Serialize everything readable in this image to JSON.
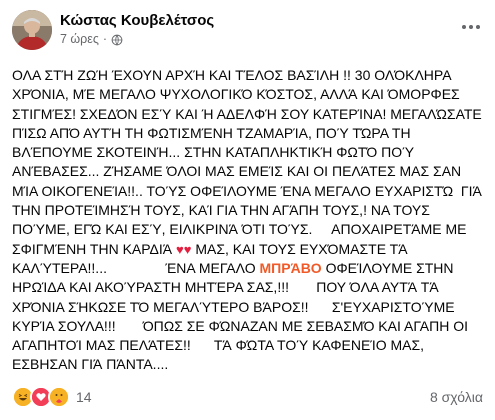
{
  "post": {
    "author": "Κώστας Κουβελέτσος",
    "time": "7 ώρες",
    "separator": "·",
    "lines": {
      "l1": "ΟΛΑ ΣΤΉ ΖΩΉ ΈΧΟΥΝ ΑΡΧΉ ΚΑΙ ΤΈΛΟΣ ΒΑΣΊΛΗ !! 30 ΟΛΌΚΛΗΡΑ",
      "l2": "ΧΡΌΝΙΑ, ΜΈ ΜΕΓΑΛΟ ΨΥΧΟΛΟΓΙΚΌ ΚΌΣΤΟΣ, ΑΛΛΆ ΚΑΙ ΌΜΟΡΦΕΣ",
      "l3": "ΣΤΙΓΜΈΣ! ΣΧΕΔΌΝ ΕΣΎ ΚΑΙ Ή ΑΔΕΛΦΉ ΣΟΥ ΚΑΤΕΡΊΝΑ! ΜΕΓΑΛΏΣΑΤΕ",
      "l4": "ΠΊΣΩ ΑΠΌ ΑΥΤΉ ΤΗ ΦΩΤΙΣΜΈΝΗ ΤΖΑΜΑΡΊΑ, ΠΟΎ ΤΏΡΑ ΤΗ",
      "l5": "ΒΛΈΠΟΥΜΕ ΣΚΟΤΕΙΝΉ... ΣΤΗΝ ΚΑΤΑΠΛΗΚΤΙΚΉ ΦΩΤΌ ΠΟΎ",
      "l6": "ΑΝΈΒΑΣΕΣ... ΖΉΣΑΜΕ ΌΛΟΙ ΜΑΣ ΕΜΕΊΣ ΚΑΙ ΟΙ ΠΕΛΆΤΕΣ ΜΑΣ ΣΑΝ",
      "l7": "ΜΊΑ ΟΙΚΟΓΕΝΕΊΑ!!.. ΤΟΎΣ ΟΦΕΊΛΟΥΜΕ ΈΝΑ ΜΕΓΑΛΟ ΕΥΧΑΡΙΣΤΏ  ΓΙΆ",
      "l8": "ΤΗΝ ΠΡΟΤΕΊΜΗΣΉ ΤΟΥΣ, ΚΑΊ ΓΙΑ ΤΗΝ ΑΓΆΠΗ ΤΟΥΣ,! ΝΑ ΤΟΥΣ",
      "l9": "ΠΟΎΜΕ, ΕΓΏ ΚΑΙ ΕΣΎ, ΕΙΛΙΚΡΙΝΆ ΌΤΙ ΤΟΎΣ.     ΑΠΟΧΑΙΡΕΤΆΜΕ ΜΕ",
      "l10a": "ΣΦΙΓΜΈΝΗ ΤΗΝ ΚΑΡΔΙΆ ",
      "l10hearts": "♥♥",
      "l10b": " ΜΑΣ, ΚΑΙ ΤΟΥΣ ΕΥΧΌΜΑΣΤΕ ΤΆ",
      "l11a": "ΚΑΛΎΤΕΡΑ!!...               ΈΝΑ ΜΕΓΑΛΟ ",
      "l11bravo": "ΜΠΡΆΒΟ",
      "l11b": " ΟΦΕΊΛΟΥΜΕ ΣΤΗΝ",
      "l12": "ΗΡΩΊΔΑ ΚΑΙ ΑΚΟΎΡΑΣΤΗ ΜΗΤΈΡΑ ΣΑΣ,!!!       ΠΟΥ ΌΛΑ ΑΥΤΆ ΤΆ",
      "l13": "ΧΡΌΝΙΑ ΣΉΚΩΣΕ ΤΌ ΜΕΓΑΛΎΤΕΡΟ ΒΆΡΟΣ!!      Σ'ΕΥΧΑΡΙΣΤΟΎΜΕ",
      "l14": "ΚΥΡΊΑ ΣΟΥΛΑ!!!       ΌΠΩΣ ΣΕ ΦΏΝΑΖΑΝ ΜΕ ΣΕΒΑΣΜΌ ΚΑΙ ΑΓΑΠΗ ΟΙ",
      "l15": "ΑΓΑΠΗΤΟΊ ΜΑΣ ΠΕΛΆΤΕΣ!!      ΤΆ ΦΏΤΑ ΤΟΎ ΚΑΦΕΝΕΊΟ ΜΑΣ,",
      "l16": "ΕΣΒΗΣΑΝ ΓΙΆ ΠΆΝΤΑ...."
    },
    "reaction_count": "14",
    "comments_label": "8 σχόλια"
  },
  "icons": {
    "avatar": "avatar-photo",
    "privacy": "globe-icon",
    "more": "more-options-icon",
    "reactions": [
      "haha-icon",
      "love-icon",
      "care-icon"
    ]
  },
  "colors": {
    "text": "#050505",
    "meta": "#65676b",
    "heart": "#e41e3f",
    "bravo": "#f05a28",
    "love": "#f33e58",
    "haha": "#f7b125"
  }
}
